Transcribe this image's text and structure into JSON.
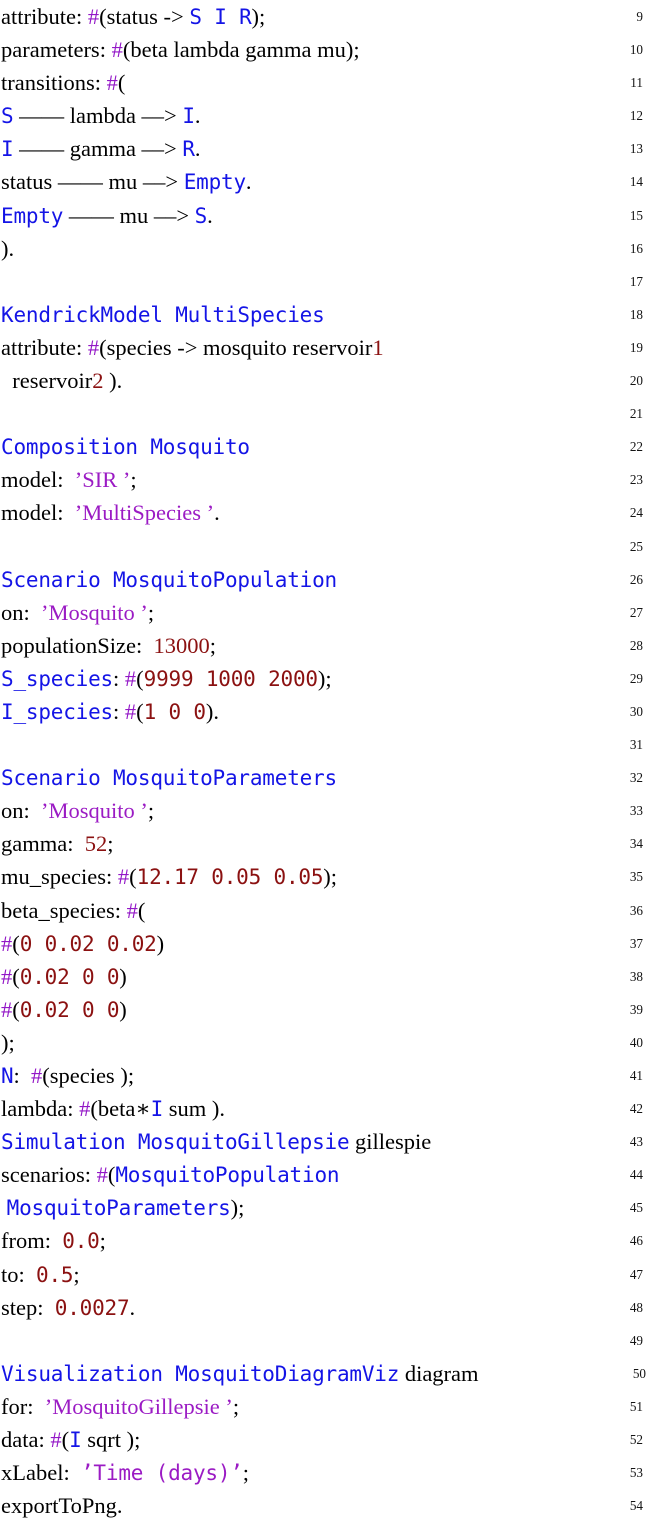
{
  "document": {
    "kind": "source-code-listing",
    "language": "Kendrick DSL",
    "line_number_range": [
      9,
      54
    ],
    "colors": {
      "background": "#ffffff",
      "default_text": "#000000",
      "keyword_blue": "#1414E6",
      "number_red": "#8B1111",
      "string_purple": "#9B1BC4",
      "hash_purple": "#9317C7",
      "line_number": "#141414"
    }
  },
  "lines": [
    {
      "number": "9",
      "tokens": [
        {
          "t": "plain",
          "s": "attribute"
        },
        {
          "t": "plain",
          "s": ": "
        },
        {
          "t": "hash",
          "s": "#"
        },
        {
          "t": "plain",
          "s": "("
        },
        {
          "t": "plain",
          "s": "status "
        },
        {
          "t": "plain",
          "s": "-> "
        },
        {
          "t": "kw",
          "s": "S I R"
        },
        {
          "t": "plain",
          "s": ");"
        }
      ]
    },
    {
      "number": "10",
      "tokens": [
        {
          "t": "plain",
          "s": "parameters"
        },
        {
          "t": "plain",
          "s": ": "
        },
        {
          "t": "hash",
          "s": "#"
        },
        {
          "t": "plain",
          "s": "("
        },
        {
          "t": "plain",
          "s": "beta lambda gamma mu"
        },
        {
          "t": "plain",
          "s": ");"
        }
      ]
    },
    {
      "number": "11",
      "tokens": [
        {
          "t": "plain",
          "s": "transitions"
        },
        {
          "t": "plain",
          "s": ": "
        },
        {
          "t": "hash",
          "s": "#"
        },
        {
          "t": "plain",
          "s": "("
        }
      ]
    },
    {
      "number": "12",
      "tokens": [
        {
          "t": "kw",
          "s": "S"
        },
        {
          "t": "plain",
          "s": " —— lambda ‒‒> "
        },
        {
          "t": "kw",
          "s": "I"
        },
        {
          "t": "plain",
          "s": "."
        }
      ]
    },
    {
      "number": "13",
      "tokens": [
        {
          "t": "kw",
          "s": "I"
        },
        {
          "t": "plain",
          "s": " —— gamma ‒‒> "
        },
        {
          "t": "kw",
          "s": "R"
        },
        {
          "t": "plain",
          "s": "."
        }
      ]
    },
    {
      "number": "14",
      "tokens": [
        {
          "t": "plain",
          "s": "status —— mu ‒‒> "
        },
        {
          "t": "kw",
          "s": "Empty"
        },
        {
          "t": "plain",
          "s": "."
        }
      ]
    },
    {
      "number": "15",
      "tokens": [
        {
          "t": "kw",
          "s": "Empty"
        },
        {
          "t": "plain",
          "s": " —— mu ‒‒> "
        },
        {
          "t": "kw",
          "s": "S"
        },
        {
          "t": "plain",
          "s": "."
        }
      ]
    },
    {
      "number": "16",
      "tokens": [
        {
          "t": "plain",
          "s": ")."
        }
      ]
    },
    {
      "number": "17",
      "tokens": []
    },
    {
      "number": "18",
      "tokens": [
        {
          "t": "kw",
          "s": "KendrickModel MultiSpecies"
        }
      ]
    },
    {
      "number": "19",
      "tokens": [
        {
          "t": "plain",
          "s": "attribute"
        },
        {
          "t": "plain",
          "s": ": "
        },
        {
          "t": "hash",
          "s": "#"
        },
        {
          "t": "plain",
          "s": "("
        },
        {
          "t": "plain",
          "s": "species -> mosquito reservoir"
        },
        {
          "t": "numser",
          "s": "1"
        }
      ]
    },
    {
      "number": "20",
      "tokens": [
        {
          "t": "plain",
          "s": "  reservoir"
        },
        {
          "t": "numser",
          "s": "2"
        },
        {
          "t": "plain",
          "s": " )."
        }
      ]
    },
    {
      "number": "21",
      "tokens": []
    },
    {
      "number": "22",
      "tokens": [
        {
          "t": "kw",
          "s": "Composition Mosquito"
        }
      ]
    },
    {
      "number": "23",
      "tokens": [
        {
          "t": "plain",
          "s": "model"
        },
        {
          "t": "plain",
          "s": ":  "
        },
        {
          "t": "str",
          "s": "’SIR ’"
        },
        {
          "t": "plain",
          "s": ";"
        }
      ]
    },
    {
      "number": "24",
      "tokens": [
        {
          "t": "plain",
          "s": "model"
        },
        {
          "t": "plain",
          "s": ":  "
        },
        {
          "t": "str",
          "s": "’MultiSpecies ’"
        },
        {
          "t": "plain",
          "s": "."
        }
      ]
    },
    {
      "number": "25",
      "tokens": []
    },
    {
      "number": "26",
      "tokens": [
        {
          "t": "kw",
          "s": "Scenario MosquitoPopulation"
        }
      ]
    },
    {
      "number": "27",
      "tokens": [
        {
          "t": "plain",
          "s": "on"
        },
        {
          "t": "plain",
          "s": ":  "
        },
        {
          "t": "str",
          "s": "’Mosquito ’"
        },
        {
          "t": "plain",
          "s": ";"
        }
      ]
    },
    {
      "number": "28",
      "tokens": [
        {
          "t": "plain",
          "s": "populationSize"
        },
        {
          "t": "plain",
          "s": ":  "
        },
        {
          "t": "numser",
          "s": "13000"
        },
        {
          "t": "plain",
          "s": ";"
        }
      ]
    },
    {
      "number": "29",
      "tokens": [
        {
          "t": "kw",
          "s": "S_species"
        },
        {
          "t": "plain",
          "s": ": "
        },
        {
          "t": "hash",
          "s": "#"
        },
        {
          "t": "plain",
          "s": "("
        },
        {
          "t": "num",
          "s": "9999 1000 2000"
        },
        {
          "t": "plain",
          "s": ");"
        }
      ]
    },
    {
      "number": "30",
      "tokens": [
        {
          "t": "kw",
          "s": "I_species"
        },
        {
          "t": "plain",
          "s": ": "
        },
        {
          "t": "hash",
          "s": "#"
        },
        {
          "t": "plain",
          "s": "("
        },
        {
          "t": "num",
          "s": "1 0 0"
        },
        {
          "t": "plain",
          "s": ")."
        }
      ]
    },
    {
      "number": "31",
      "tokens": []
    },
    {
      "number": "32",
      "tokens": [
        {
          "t": "kw",
          "s": "Scenario MosquitoParameters"
        }
      ]
    },
    {
      "number": "33",
      "tokens": [
        {
          "t": "plain",
          "s": "on"
        },
        {
          "t": "plain",
          "s": ":  "
        },
        {
          "t": "str",
          "s": "’Mosquito ’"
        },
        {
          "t": "plain",
          "s": ";"
        }
      ]
    },
    {
      "number": "34",
      "tokens": [
        {
          "t": "plain",
          "s": "gamma"
        },
        {
          "t": "plain",
          "s": ":  "
        },
        {
          "t": "numser",
          "s": "52"
        },
        {
          "t": "plain",
          "s": ";"
        }
      ]
    },
    {
      "number": "35",
      "tokens": [
        {
          "t": "plain",
          "s": "mu_species"
        },
        {
          "t": "plain",
          "s": ": "
        },
        {
          "t": "hash",
          "s": "#"
        },
        {
          "t": "plain",
          "s": "("
        },
        {
          "t": "num",
          "s": "12.17 0.05 0.05"
        },
        {
          "t": "plain",
          "s": ");"
        }
      ]
    },
    {
      "number": "36",
      "tokens": [
        {
          "t": "plain",
          "s": "beta_species"
        },
        {
          "t": "plain",
          "s": ": "
        },
        {
          "t": "hash",
          "s": "#"
        },
        {
          "t": "plain",
          "s": "("
        }
      ]
    },
    {
      "number": "37",
      "tokens": [
        {
          "t": "hash",
          "s": "#"
        },
        {
          "t": "plain",
          "s": "("
        },
        {
          "t": "num",
          "s": "0 0.02 0.02"
        },
        {
          "t": "plain",
          "s": ")"
        }
      ]
    },
    {
      "number": "38",
      "tokens": [
        {
          "t": "hash",
          "s": "#"
        },
        {
          "t": "plain",
          "s": "("
        },
        {
          "t": "num",
          "s": "0.02 0 0"
        },
        {
          "t": "plain",
          "s": ")"
        }
      ]
    },
    {
      "number": "39",
      "tokens": [
        {
          "t": "hash",
          "s": "#"
        },
        {
          "t": "plain",
          "s": "("
        },
        {
          "t": "num",
          "s": "0.02 0 0"
        },
        {
          "t": "plain",
          "s": ")"
        }
      ]
    },
    {
      "number": "40",
      "tokens": [
        {
          "t": "plain",
          "s": ");"
        }
      ]
    },
    {
      "number": "41",
      "tokens": [
        {
          "t": "kw",
          "s": "N"
        },
        {
          "t": "plain",
          "s": ":  "
        },
        {
          "t": "hash",
          "s": "#"
        },
        {
          "t": "plain",
          "s": "("
        },
        {
          "t": "plain",
          "s": "species"
        },
        {
          "t": "plain",
          "s": " );"
        }
      ]
    },
    {
      "number": "42",
      "tokens": [
        {
          "t": "plain",
          "s": "lambda"
        },
        {
          "t": "plain",
          "s": ": "
        },
        {
          "t": "hash",
          "s": "#"
        },
        {
          "t": "plain",
          "s": "("
        },
        {
          "t": "plain",
          "s": "beta∗"
        },
        {
          "t": "kw",
          "s": "I"
        },
        {
          "t": "plain",
          "s": " sum )."
        }
      ]
    },
    {
      "number": "43",
      "tokens": [
        {
          "t": "kw",
          "s": "Simulation MosquitoGillepsie"
        },
        {
          "t": "plain",
          "s": " gillespie"
        }
      ]
    },
    {
      "number": "44",
      "tokens": [
        {
          "t": "plain",
          "s": "scenarios"
        },
        {
          "t": "plain",
          "s": ": "
        },
        {
          "t": "hash",
          "s": "#"
        },
        {
          "t": "plain",
          "s": "("
        },
        {
          "t": "kw",
          "s": "MosquitoPopulation"
        }
      ]
    },
    {
      "number": "45",
      "tokens": [
        {
          "t": "plain",
          "s": " "
        },
        {
          "t": "kw",
          "s": "MosquitoParameters"
        },
        {
          "t": "plain",
          "s": ");"
        }
      ]
    },
    {
      "number": "46",
      "tokens": [
        {
          "t": "plain",
          "s": "from"
        },
        {
          "t": "plain",
          "s": ":  "
        },
        {
          "t": "num",
          "s": "0.0"
        },
        {
          "t": "plain",
          "s": ";"
        }
      ]
    },
    {
      "number": "47",
      "tokens": [
        {
          "t": "plain",
          "s": "to"
        },
        {
          "t": "plain",
          "s": ":  "
        },
        {
          "t": "num",
          "s": "0.5"
        },
        {
          "t": "plain",
          "s": ";"
        }
      ]
    },
    {
      "number": "48",
      "tokens": [
        {
          "t": "plain",
          "s": "step"
        },
        {
          "t": "plain",
          "s": ":  "
        },
        {
          "t": "num",
          "s": "0.0027"
        },
        {
          "t": "plain",
          "s": "."
        }
      ]
    },
    {
      "number": "49",
      "tokens": []
    },
    {
      "number": "50",
      "wide": true,
      "tokens": [
        {
          "t": "kw",
          "s": "Visualization MosquitoDiagramViz"
        },
        {
          "t": "plain",
          "s": " diagram"
        }
      ]
    },
    {
      "number": "51",
      "tokens": [
        {
          "t": "plain",
          "s": "for"
        },
        {
          "t": "plain",
          "s": ":  "
        },
        {
          "t": "str",
          "s": "’MosquitoGillepsie ’"
        },
        {
          "t": "plain",
          "s": ";"
        }
      ]
    },
    {
      "number": "52",
      "tokens": [
        {
          "t": "plain",
          "s": "data"
        },
        {
          "t": "plain",
          "s": ": "
        },
        {
          "t": "hash",
          "s": "#"
        },
        {
          "t": "plain",
          "s": "("
        },
        {
          "t": "kw",
          "s": "I"
        },
        {
          "t": "plain",
          "s": " sqrt );"
        }
      ]
    },
    {
      "number": "53",
      "tokens": [
        {
          "t": "plain",
          "s": "xLabel"
        },
        {
          "t": "plain",
          "s": ":  "
        },
        {
          "t": "strm",
          "s": "’Time (days)’"
        },
        {
          "t": "plain",
          "s": ";"
        }
      ]
    },
    {
      "number": "54",
      "tokens": [
        {
          "t": "plain",
          "s": "exportToPng"
        },
        {
          "t": "plain",
          "s": "."
        }
      ]
    }
  ]
}
